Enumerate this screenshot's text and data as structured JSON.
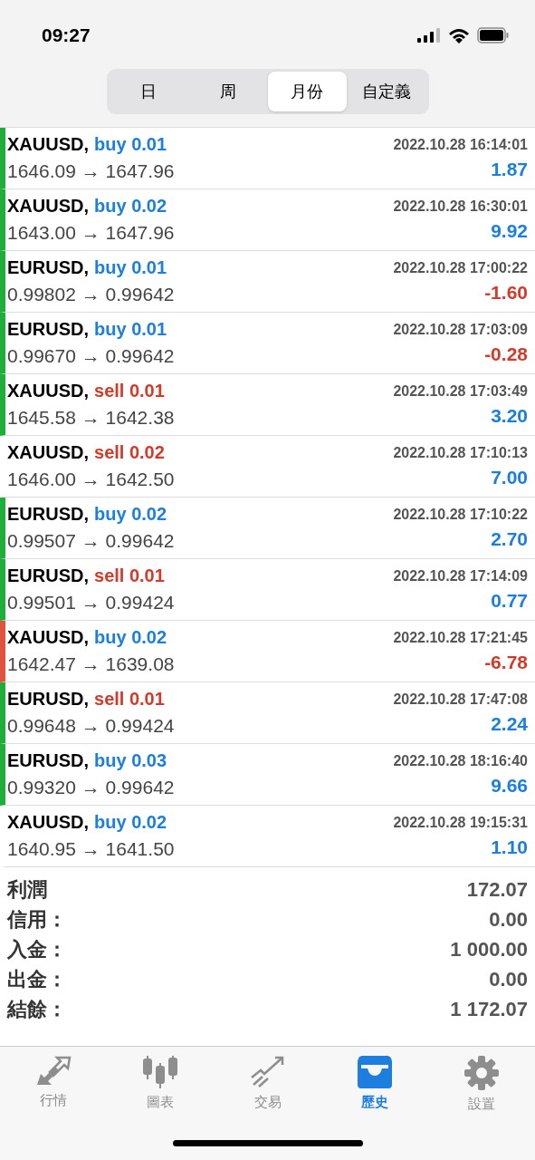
{
  "status_bar": {
    "time": "09:27"
  },
  "period_tabs": [
    {
      "label": "日",
      "selected": false
    },
    {
      "label": "周",
      "selected": false
    },
    {
      "label": "月份",
      "selected": true
    },
    {
      "label": "自定義",
      "selected": false
    }
  ],
  "deals": [
    {
      "symbol": "XAUUSD,",
      "kind": "buy",
      "order": "buy 0.01",
      "prices": "1646.09 → 1647.96",
      "time": "2022.10.28 16:14:01",
      "profit": "1.87",
      "loss": false,
      "color": "#1fae3b"
    },
    {
      "symbol": "XAUUSD,",
      "kind": "buy",
      "order": "buy 0.02",
      "prices": "1643.00 → 1647.96",
      "time": "2022.10.28 16:30:01",
      "profit": "9.92",
      "loss": false,
      "color": "#1fae3b"
    },
    {
      "symbol": "EURUSD,",
      "kind": "buy",
      "order": "buy 0.01",
      "prices": "0.99802 → 0.99642",
      "time": "2022.10.28 17:00:22",
      "profit": "-1.60",
      "loss": true,
      "color": "#1fae3b"
    },
    {
      "symbol": "EURUSD,",
      "kind": "buy",
      "order": "buy 0.01",
      "prices": "0.99670 → 0.99642",
      "time": "2022.10.28 17:03:09",
      "profit": "-0.28",
      "loss": true,
      "color": "#1fae3b"
    },
    {
      "symbol": "XAUUSD,",
      "kind": "sell",
      "order": "sell 0.01",
      "prices": "1645.58 → 1642.38",
      "time": "2022.10.28 17:03:49",
      "profit": "3.20",
      "loss": false,
      "color": "#1fae3b"
    },
    {
      "symbol": "XAUUSD,",
      "kind": "sell",
      "order": "sell 0.02",
      "prices": "1646.00 → 1642.50",
      "time": "2022.10.28 17:10:13",
      "profit": "7.00",
      "loss": false
    },
    {
      "symbol": "EURUSD,",
      "kind": "buy",
      "order": "buy 0.02",
      "prices": "0.99507 → 0.99642",
      "time": "2022.10.28 17:10:22",
      "profit": "2.70",
      "loss": false,
      "color": "#1fae3b"
    },
    {
      "symbol": "EURUSD,",
      "kind": "sell",
      "order": "sell 0.01",
      "prices": "0.99501 → 0.99424",
      "time": "2022.10.28 17:14:09",
      "profit": "0.77",
      "loss": false,
      "color": "#1fae3b"
    },
    {
      "symbol": "XAUUSD,",
      "kind": "buy",
      "order": "buy 0.02",
      "prices": "1642.47 → 1639.08",
      "time": "2022.10.28 17:21:45",
      "profit": "-6.78",
      "loss": true,
      "color": "#e0533f"
    },
    {
      "symbol": "EURUSD,",
      "kind": "sell",
      "order": "sell 0.01",
      "prices": "0.99648 → 0.99424",
      "time": "2022.10.28 17:47:08",
      "profit": "2.24",
      "loss": false,
      "color": "#1fae3b"
    },
    {
      "symbol": "EURUSD,",
      "kind": "buy",
      "order": "buy 0.03",
      "prices": "0.99320 → 0.99642",
      "time": "2022.10.28 18:16:40",
      "profit": "9.66",
      "loss": false,
      "color": "#1fae3b"
    },
    {
      "symbol": "XAUUSD,",
      "kind": "buy",
      "order": "buy 0.02",
      "prices": "1640.95 → 1641.50",
      "time": "2022.10.28 19:15:31",
      "profit": "1.10",
      "loss": false
    }
  ],
  "summary": [
    {
      "label": "利潤",
      "value": "172.07"
    },
    {
      "label": "信用：",
      "value": "0.00"
    },
    {
      "label": "入金：",
      "value": "1 000.00"
    },
    {
      "label": "出金：",
      "value": "0.00"
    },
    {
      "label": "結餘：",
      "value": "1 172.07"
    }
  ],
  "tab_bar": [
    {
      "label": "行情",
      "kind": "arrows",
      "selected": false
    },
    {
      "label": "圖表",
      "kind": "candles",
      "selected": false
    },
    {
      "label": "交易",
      "kind": "trend",
      "selected": false
    },
    {
      "label": "歷史",
      "kind": "tray",
      "selected": true
    },
    {
      "label": "設置",
      "kind": "gear",
      "selected": false
    }
  ]
}
